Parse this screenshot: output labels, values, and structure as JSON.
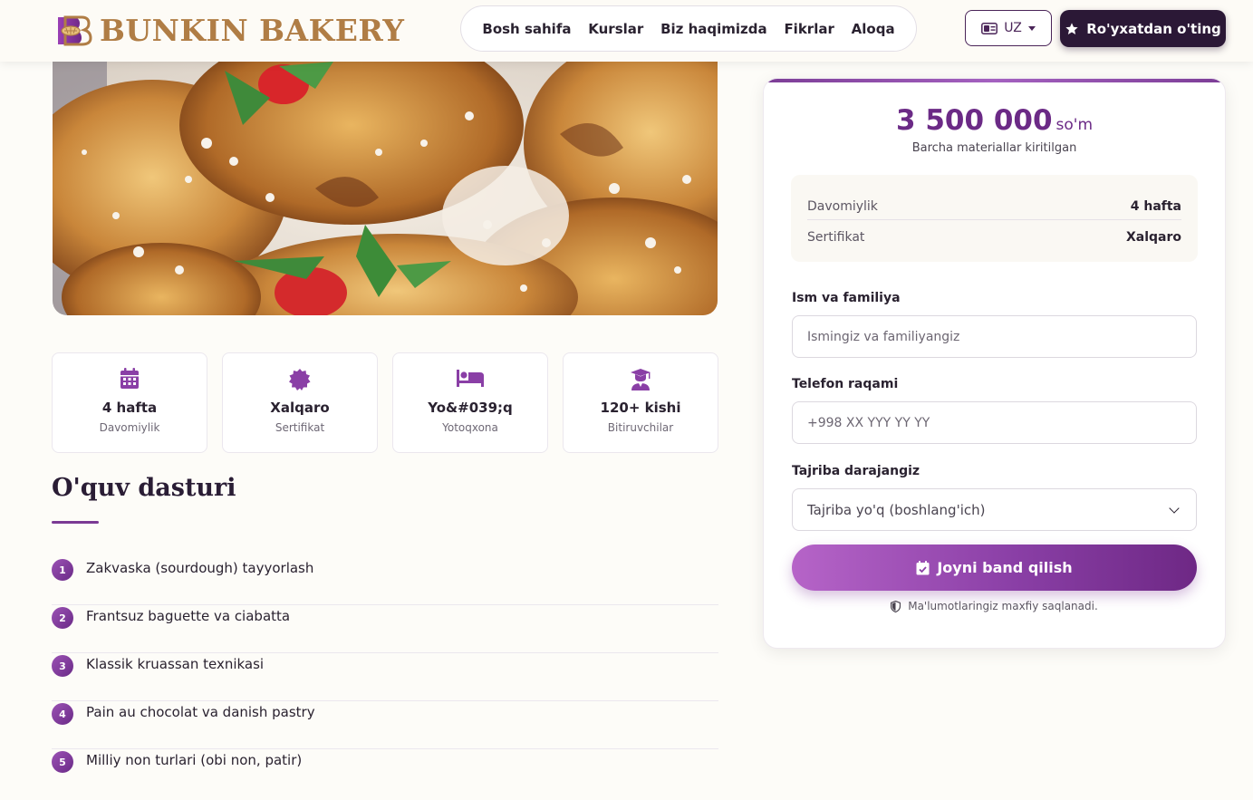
{
  "header": {
    "logo_text": "BUNKIN BAKERY",
    "nav": [
      "Bosh sahifa",
      "Kurslar",
      "Biz haqimizda",
      "Fikrlar",
      "Aloqa"
    ],
    "lang": "UZ",
    "register": "Ro'yxatdan o'ting"
  },
  "stats": [
    {
      "value": "4 hafta",
      "label": "Davomiylik",
      "icon": "calendar-icon"
    },
    {
      "value": "Xalqaro",
      "label": "Sertifikat",
      "icon": "certificate-icon"
    },
    {
      "value": "Yo&#039;q",
      "label": "Yotoqxona",
      "icon": "bed-icon"
    },
    {
      "value": "120+ kishi",
      "label": "Bitiruvchilar",
      "icon": "graduate-icon"
    }
  ],
  "curriculum": {
    "title": "O'quv dasturi",
    "items": [
      {
        "num": "1",
        "text": "Zakvaska (sourdough) tayyorlash"
      },
      {
        "num": "2",
        "text": "Frantsuz baguette va ciabatta"
      },
      {
        "num": "3",
        "text": "Klassik kruassan texnikasi"
      },
      {
        "num": "4",
        "text": "Pain au chocolat va danish pastry"
      },
      {
        "num": "5",
        "text": "Milliy non turlari (obi non, patir)"
      }
    ]
  },
  "booking": {
    "price": "3 500 000",
    "currency": "so'm",
    "price_note": "Barcha materiallar kiritilgan",
    "info": [
      {
        "key": "Davomiylik",
        "value": "4 hafta"
      },
      {
        "key": "Sertifikat",
        "value": "Xalqaro"
      }
    ],
    "name_label": "Ism va familiya",
    "name_placeholder": "Ismingiz va familiyangiz",
    "phone_label": "Telefon raqami",
    "phone_placeholder": "+998 XX YYY YY YY",
    "level_label": "Tajriba darajangiz",
    "level_value": "Tajriba yo'q (boshlang'ich)",
    "submit": "Joyni band qilish",
    "privacy": "Ma'lumotlaringiz maxfiy saqlanadi."
  },
  "colors": {
    "accent": "#7b3a94",
    "dark": "#2b1836",
    "gold": "#b07d45"
  }
}
